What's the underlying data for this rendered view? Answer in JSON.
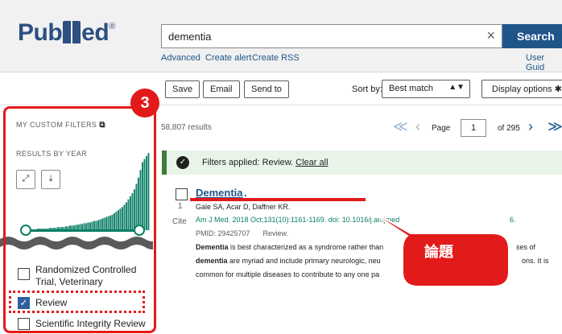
{
  "header": {
    "logo_part1": "Pub",
    "logo_part2": "ed",
    "logo_reg": "®",
    "search_value": "dementia",
    "clear_icon": "×",
    "search_button": "Search",
    "links": [
      "Advanced",
      "Create alert",
      "Create RSS"
    ],
    "user_guide": "User Guid"
  },
  "toolbar": {
    "save": "Save",
    "email": "Email",
    "send_to": "Send to",
    "sort_label": "Sort by:",
    "sort_value": "Best match",
    "display_options": "Display options"
  },
  "sidebar": {
    "custom_filters": "MY CUSTOM FILTERS",
    "results_by_year": "RESULTS BY YEAR",
    "histogram_values": [
      1,
      1,
      1,
      1,
      1,
      1,
      1,
      1,
      2,
      2,
      2,
      2,
      2,
      2,
      3,
      3,
      3,
      3,
      4,
      4,
      4,
      4,
      5,
      5,
      6,
      6,
      6,
      7,
      7,
      8,
      8,
      9,
      9,
      10,
      10,
      11,
      12,
      12,
      13,
      14,
      15,
      16,
      17,
      18,
      19,
      20,
      22,
      24,
      26,
      28,
      30,
      33,
      36,
      40,
      44,
      48,
      53,
      60,
      68,
      78,
      88,
      92,
      96,
      100
    ],
    "filters": [
      {
        "label_line1": "Randomized Controlled",
        "label_line2": "Trial, Veterinary",
        "checked": false
      },
      {
        "label_line1": "Review",
        "checked": true
      },
      {
        "label_line1": "Scientific Integrity Review",
        "checked": false
      }
    ]
  },
  "results": {
    "count": "58,807 results",
    "page_label": "Page",
    "page_value": "1",
    "page_of": "of 295",
    "banner_prefix": "Filters applied: Review. ",
    "banner_clear": "Clear all",
    "item": {
      "number": "1",
      "cite": "Cite",
      "title": "Dementia",
      "title_dot": ".",
      "authors": "Gale SA, Acar D, Daffner KR.",
      "journal": "Am J Med. 2018 Oct;131(10):1161-1169. doi: 10.1016/j.amjmed",
      "journal_tail": "6.",
      "pmid": "PMID: 29425707",
      "type": "Review.",
      "snippet1_bold": "Dementia",
      "snippet1_rest": " is best characterized as a syndrome rather than",
      "snippet1_tail": "ses of",
      "snippet2_bold": "dementia",
      "snippet2_rest": " are myriad and include primary neurologic, neu",
      "snippet2_tail": "ons. It is",
      "snippet3": "common for multiple diseases to contribute to any one pa"
    }
  },
  "annotations": {
    "badge_number": "3",
    "callout_label": "論題"
  },
  "colors": {
    "accent_red": "#e31a1a",
    "pubmed_blue": "#20558a",
    "histogram_teal": "#0b7f66"
  }
}
